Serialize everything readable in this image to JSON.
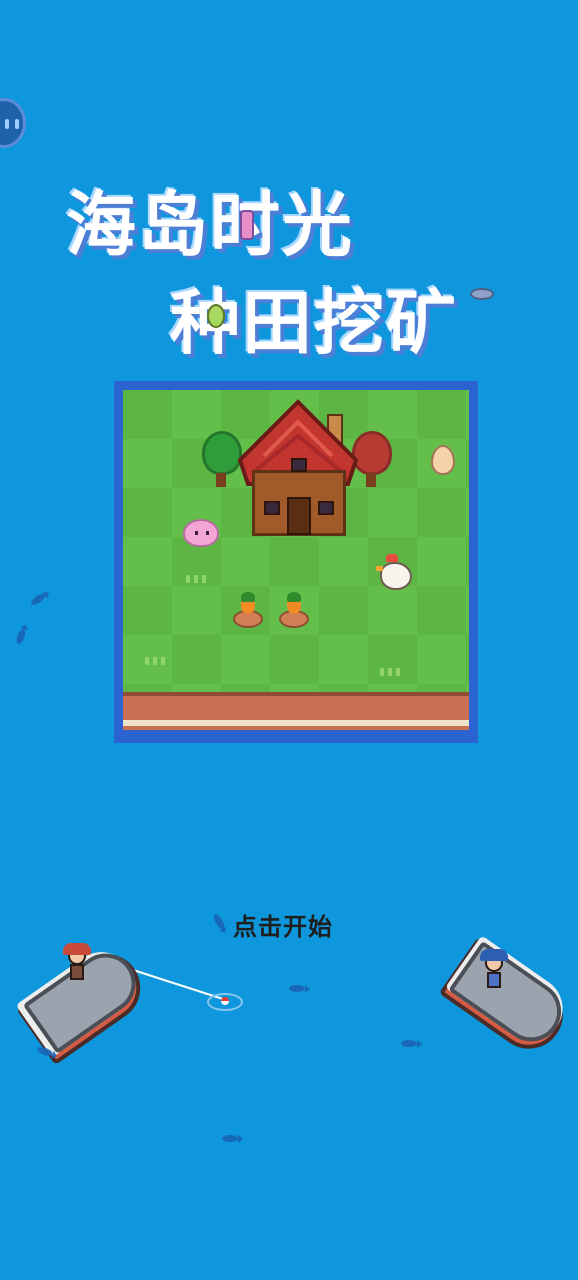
{
  "title": {
    "line1": "海岛时光",
    "line2": "种田挖矿"
  },
  "start_prompt": "点击开始",
  "menu_button": {
    "icon": "pause-face-icon"
  },
  "colors": {
    "ocean": "#0E97DC",
    "water_edge": "#2B63D1",
    "grass": "#5DB544",
    "roof": "#C3352F",
    "cliff": "#C96F52"
  },
  "scene": {
    "island_objects": [
      "house",
      "tree",
      "tree",
      "pig",
      "egg",
      "chicken",
      "carrot",
      "carrot",
      "grass-tuft"
    ],
    "boats": [
      "left-boat",
      "right-boat"
    ]
  }
}
